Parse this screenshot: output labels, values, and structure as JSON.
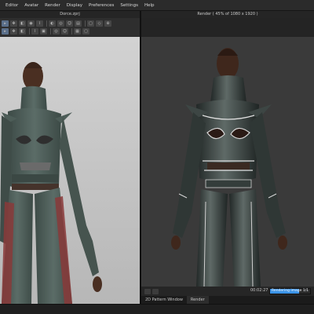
{
  "menubar": {
    "items": [
      "Editor",
      "Avatar",
      "Render",
      "Display",
      "Preferences",
      "Settings",
      "Help"
    ]
  },
  "left_panel": {
    "title": "Dorce.zprj"
  },
  "right_panel": {
    "title": "Render ( 45% of 1080 x 1920 )"
  },
  "toolbar": {
    "row1_icons": [
      "cursor-icon",
      "transform-icon",
      "fold-icon",
      "pin-icon",
      "sewing-icon",
      "sep",
      "camera-icon",
      "shade-icon",
      "xray-icon",
      "avatar-icon",
      "sep",
      "strain-icon",
      "stress-icon",
      "fit-icon"
    ],
    "row2_icons": [
      "select-icon",
      "move-icon",
      "tack-icon",
      "sep",
      "fabric-icon",
      "texture-icon",
      "sep",
      "zoom-icon",
      "grid-icon",
      "sep",
      "light-icon",
      "render-icon"
    ]
  },
  "render_status": {
    "time": "00:02:27",
    "progress_label": "Rendering image 1/1",
    "progress_value": 0.72
  },
  "tabs": [
    "2D Pattern Window",
    "Render"
  ],
  "colors": {
    "garment": "#4a5a55",
    "garment_render": "#2c3230",
    "accent_stripe": "#8a3a3a",
    "skin": "#5a3a2a",
    "progress": "#3b93e6"
  }
}
